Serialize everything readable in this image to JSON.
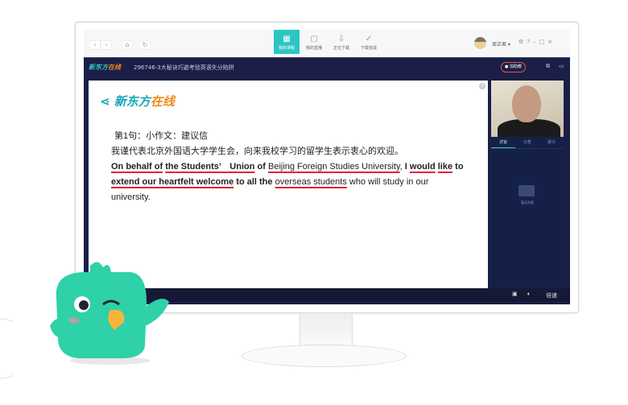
{
  "toolbar": {
    "tabs": [
      {
        "label": "我的课程",
        "icon": "grid-icon"
      },
      {
        "label": "我的直播",
        "icon": "live-icon"
      },
      {
        "label": "正在下载",
        "icon": "download-icon"
      },
      {
        "label": "下载完成",
        "icon": "check-icon"
      }
    ],
    "user": "周正君 ▾"
  },
  "header": {
    "brand": "新东方",
    "brand2": "在线",
    "title": "296746-3大秘诀巧避考验英语失分陷阱",
    "help_label": "加助教"
  },
  "slide": {
    "logo1": "新东方",
    "logo2": "在线",
    "heading": "第1句：小作文：建议信",
    "chinese": "我谨代表北京外国语大学学生会，向来我校学习的留学生表示衷心的欢迎。",
    "s": [
      "On behalf of",
      "the Students’　Union",
      "of",
      "Beijing Foreign Studies University",
      ",",
      "I",
      "would",
      "like",
      "to",
      "extend our heartfelt welcome",
      "to all the",
      "overseas students",
      "who will study in our university."
    ]
  },
  "side": {
    "tabs": [
      "讨论",
      "公告",
      "讲义"
    ],
    "empty": "暂无消息"
  },
  "bottom": {
    "speed": "倍速"
  }
}
